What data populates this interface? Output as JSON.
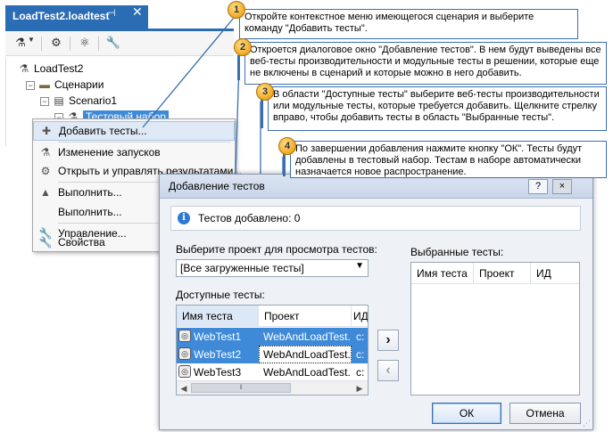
{
  "colors": {
    "accent": "#2a6db5",
    "selection": "#3f8ad8",
    "callout_border": "#3a6fb0",
    "callout_badge": "#f0a820",
    "dialog_bg": "#eef1f6"
  },
  "document_tab": {
    "title": "LoadTest2.loadtest",
    "pin_icon": "pin-icon",
    "close_icon": "close-icon"
  },
  "explorer_toolbar": {
    "icons": [
      "add-plugin-icon",
      "dropdown-arrow-icon",
      "manage-counters-icon",
      "settings-icon",
      "properties-wrench-icon"
    ]
  },
  "tree": {
    "root": "LoadTest2",
    "scenarios_folder": "Сценарии",
    "scenario": "Scenario1",
    "test_mix": "Тестовый набор"
  },
  "context_menu": {
    "items": [
      {
        "label": "Добавить тесты...",
        "icon": "add-tests-icon"
      },
      {
        "label": "Изменение запусков",
        "icon": "flask-icon"
      },
      {
        "label": "Открыть и управлять результатами...",
        "icon": "results-icon"
      },
      {
        "label": "Выполнить...",
        "icon": "run-icon"
      },
      {
        "label": "Выполнить...",
        "icon": ""
      },
      {
        "label": "Управление...",
        "icon": "wrench-icon"
      },
      {
        "label": "Свойства",
        "icon": "properties-icon"
      }
    ]
  },
  "callouts": [
    {
      "number": "1",
      "text": "Откройте контекстное меню имеющегося сценария и выберите команду \"Добавить тесты\"."
    },
    {
      "number": "2",
      "text": "Откроется диалоговое окно \"Добавление тестов\". В нем будут выведены все веб-тесты производительности и модульные тесты в решении, которые еще не включены в сценарий и которые можно в него добавить."
    },
    {
      "number": "3",
      "text": "В области \"Доступные тесты\" выберите веб-тесты производительности или модульные тесты, которые требуется добавить. Щелкните стрелку вправо, чтобы добавить тесты в область \"Выбранные тесты\"."
    },
    {
      "number": "4",
      "text": "По завершении добавления нажмите кнопку \"ОК\". Тесты будут добавлены в тестовый набор. Тестам в наборе автоматически назначается новое распространение."
    }
  ],
  "dialog": {
    "title": "Добавление тестов",
    "help_button": "?",
    "close_button": "×",
    "info_text": "Тестов добавлено: 0",
    "project_label": "Выберите проект для просмотра тестов:",
    "project_value": "[Все загруженные тесты]",
    "available_label": "Доступные тесты:",
    "selected_label": "Выбранные тесты:",
    "columns": [
      "Имя теста",
      "Проект",
      "ИД"
    ],
    "available_tests": [
      {
        "name": "WebTest1",
        "project": "WebAndLoadTest...",
        "id": "c:",
        "selected": true
      },
      {
        "name": "WebTest2",
        "project": "WebAndLoadTest...",
        "id": "c:",
        "selected": true
      },
      {
        "name": "WebTest3",
        "project": "WebAndLoadTest...",
        "id": "c:",
        "selected": false
      }
    ],
    "move_right_label": "›",
    "move_left_label": "‹",
    "ok_label": "ОК",
    "cancel_label": "Отмена"
  }
}
